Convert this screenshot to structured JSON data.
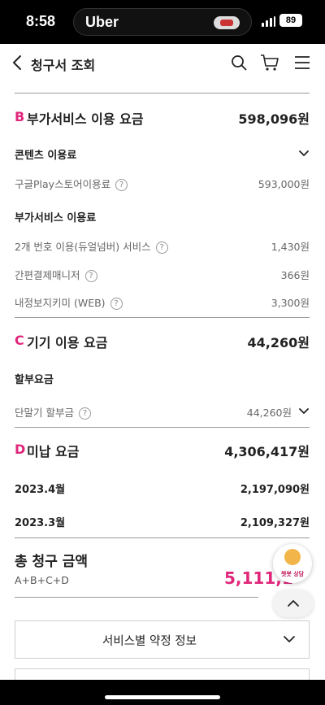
{
  "status_bar": {
    "time": "8:58",
    "island_app": "Uber",
    "battery": "89"
  },
  "header": {
    "title": "청구서 조회"
  },
  "sections": [
    {
      "letter": "B",
      "title": "부가서비스 이용 요금",
      "amount": "598,096원",
      "groups": [
        {
          "title": "콘텐츠 이용료",
          "items": [
            {
              "label": "구글Play스토어이용료",
              "value": "593,000원"
            }
          ]
        },
        {
          "title": "부가서비스 이용료",
          "items": [
            {
              "label": "2개 번호 이용(듀얼넘버) 서비스",
              "value": "1,430원"
            },
            {
              "label": "간편결제매니저",
              "value": "366원"
            },
            {
              "label": "내정보지키미 (WEB)",
              "value": "3,300원"
            }
          ]
        }
      ]
    },
    {
      "letter": "C",
      "title": "기기 이용 요금",
      "amount": "44,260원",
      "groups": [
        {
          "title": "할부요금",
          "items": [
            {
              "label": "단말기 할부금",
              "value": "44,260원"
            }
          ]
        }
      ]
    },
    {
      "letter": "D",
      "title": "미납 요금",
      "amount": "4,306,417원",
      "months": [
        {
          "label": "2023.4월",
          "value": "2,197,090원"
        },
        {
          "label": "2023.3월",
          "value": "2,109,327원"
        }
      ]
    }
  ],
  "total": {
    "title": "총 청구 금액",
    "formula": "A+B+C+D",
    "amount": "5,111,1"
  },
  "chatbot": {
    "label": "챗봇 상담"
  },
  "accordion": {
    "label": "서비스별 약정 정보"
  },
  "icons": [
    "back-icon",
    "search-icon",
    "cart-icon",
    "menu-icon",
    "help-icon",
    "chevron-down-icon",
    "chevron-up-icon"
  ],
  "colors": {
    "accent": "#e0267a",
    "divider": "#9a9a9a"
  }
}
